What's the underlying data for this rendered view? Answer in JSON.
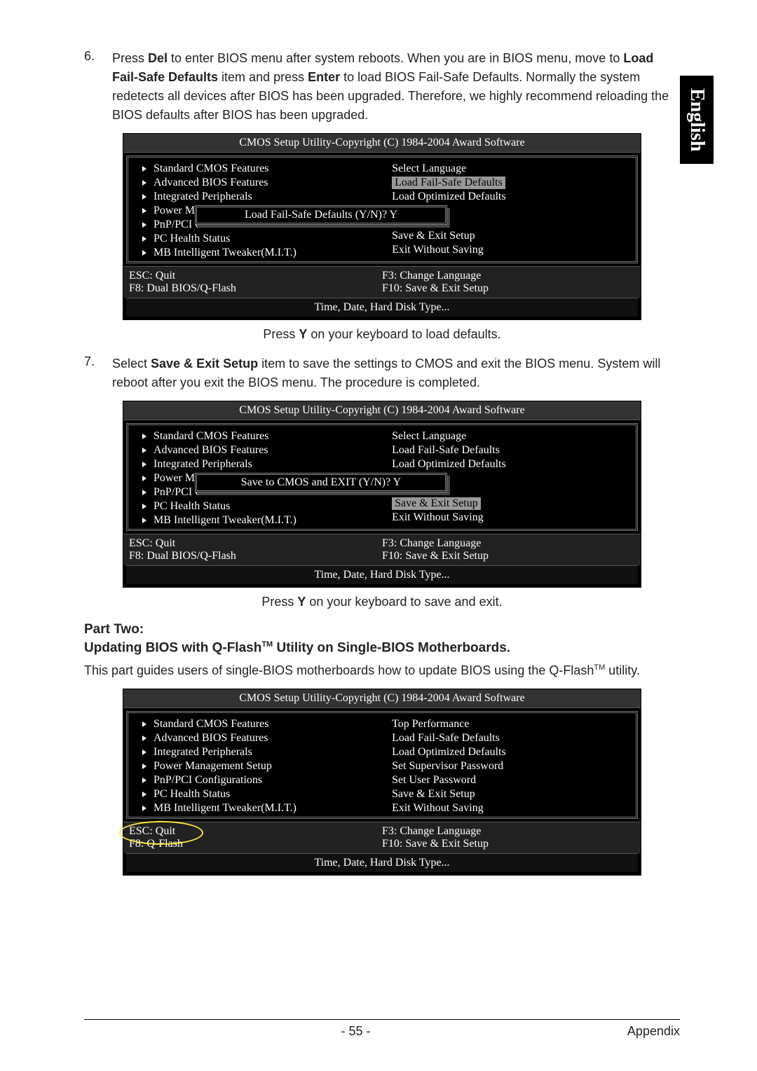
{
  "lang_tab": "English",
  "steps": {
    "s6_num": "6.",
    "s6_text_1": "Press ",
    "s6_b1": "Del",
    "s6_text_2": " to enter BIOS menu after system reboots. When you are in BIOS menu, move to ",
    "s6_b2": "Load Fail-Safe Defaults",
    "s6_text_3": " item and press ",
    "s6_b3": "Enter",
    "s6_text_4": " to load BIOS Fail-Safe Defaults. Normally the system redetects all devices after BIOS has been upgraded. Therefore, we highly recommend reloading the BIOS defaults after BIOS has been upgraded.",
    "s7_num": "7.",
    "s7_text_1": "Select ",
    "s7_b1": "Save & Exit Setup",
    "s7_text_2": " item to save the settings to CMOS and exit the BIOS menu. System will reboot after you exit the BIOS menu. The procedure is completed."
  },
  "bios": {
    "title": "CMOS Setup Utility-Copyright (C) 1984-2004 Award Software",
    "left": [
      "Standard CMOS Features",
      "Advanced BIOS Features",
      "Integrated Peripherals",
      "Power Management Setup",
      "PnP/PCI Configurations",
      "PC Health Status",
      "MB Intelligent Tweaker(M.I.T.)"
    ],
    "left_trunc": {
      "power": "Power Mana",
      "pnp": "PnP/PCI Cor"
    },
    "right_dual": [
      "Select Language",
      "Load Fail-Safe Defaults",
      "Load Optimized Defaults",
      "Save & Exit Setup",
      "Exit Without Saving"
    ],
    "right_single": [
      "Top Performance",
      "Load Fail-Safe Defaults",
      "Load Optimized Defaults",
      "Set Supervisor Password",
      "Set User Password",
      "Save & Exit Setup",
      "Exit Without Saving"
    ],
    "dialog1": "Load Fail-Safe Defaults (Y/N)? Y",
    "dialog2": "Save to CMOS and EXIT (Y/N)? Y",
    "foot_dual": {
      "esc": "ESC: Quit",
      "f3": "F3: Change Language",
      "f8": "F8: Dual BIOS/Q-Flash",
      "f10": "F10: Save & Exit Setup"
    },
    "foot_single": {
      "esc": "ESC: Quit",
      "f3": "F3: Change Language",
      "f8": "F8: Q-Flash",
      "f10": "F10: Save & Exit Setup"
    },
    "help": "Time, Date, Hard Disk Type..."
  },
  "cap1_pre": "Press ",
  "cap1_b": "Y",
  "cap1_post": " on your keyboard to load defaults.",
  "cap2_pre": "Press ",
  "cap2_b": "Y",
  "cap2_post": " on your keyboard to save and exit.",
  "part_two": "Part Two:",
  "subtitle_pre": "Updating BIOS with Q-Flash",
  "subtitle_tm": "TM",
  "subtitle_post": " Utility on Single-BIOS Motherboards.",
  "body2_pre": "This part guides users of single-BIOS motherboards how to update BIOS using the Q-Flash",
  "body2_tm": "TM",
  "body2_post": " utility.",
  "footer": {
    "page": "- 55 -",
    "section": "Appendix"
  }
}
